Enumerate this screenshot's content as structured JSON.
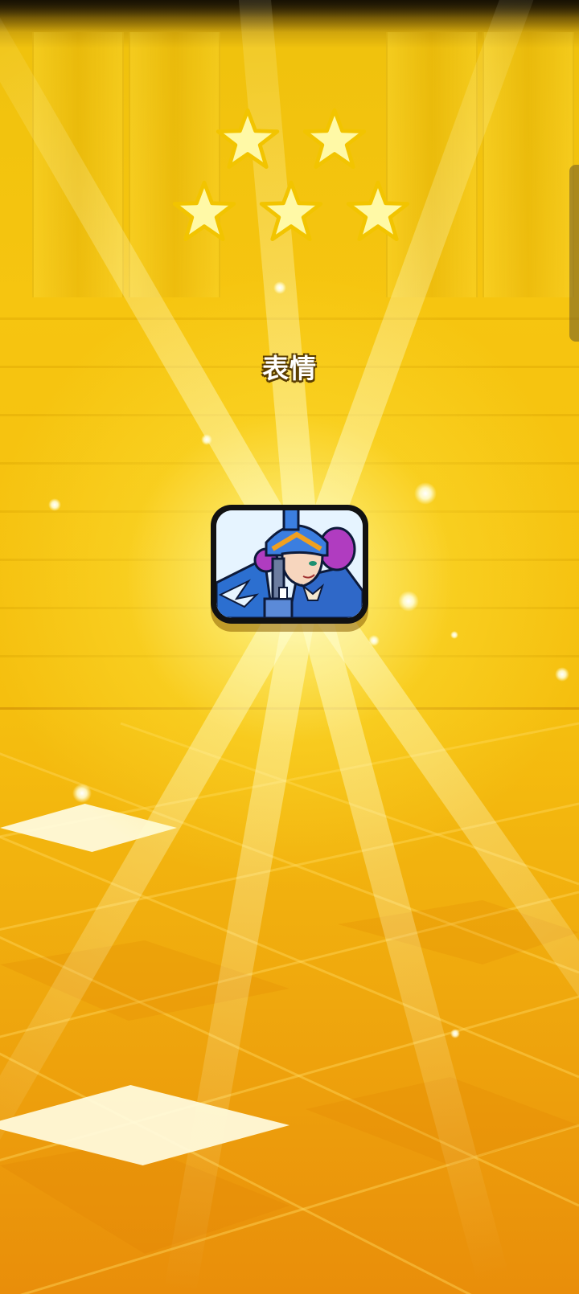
{
  "screen": {
    "title": "表情",
    "star_count": 5,
    "star_rows": [
      2,
      3
    ],
    "reward_icon": "musketeer-emote-icon"
  },
  "colors": {
    "background_gold": "#f6c510",
    "star_fill": "#fff9a6",
    "star_outline": "#f2c400",
    "card_border": "#111111",
    "title_text": "#ffffff"
  }
}
